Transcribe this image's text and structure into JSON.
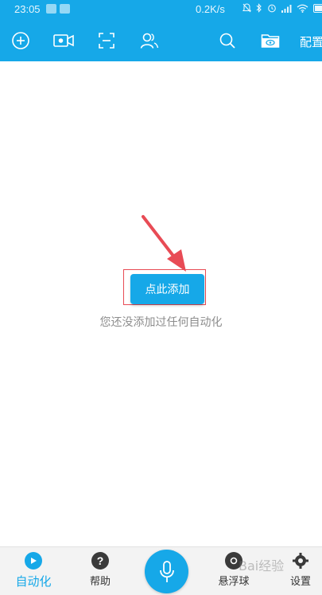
{
  "status_bar": {
    "time": "23:05",
    "network_speed": "0.2K/s"
  },
  "toolbar": {
    "icons": [
      "add-circle-icon",
      "video-camera-icon",
      "scan-frame-icon",
      "contacts-icon",
      "search-icon",
      "folder-eye-icon"
    ],
    "config_label": "配置"
  },
  "content": {
    "add_button_label": "点此添加",
    "empty_hint": "您还没添加过任何自动化"
  },
  "bottom_nav": {
    "items": [
      {
        "label": "自动化",
        "icon": "play-circle-icon",
        "active": true
      },
      {
        "label": "帮助",
        "icon": "help-circle-icon",
        "active": false
      },
      {
        "label": "悬浮球",
        "icon": "float-ball-icon",
        "active": false
      },
      {
        "label": "设置",
        "icon": "gear-icon",
        "active": false
      }
    ],
    "mic_icon": "microphone-icon"
  },
  "watermark": "Bai经验",
  "colors": {
    "primary": "#16a8e8",
    "annotation_red": "#e84b55",
    "hint_gray": "#8d8d8d"
  }
}
